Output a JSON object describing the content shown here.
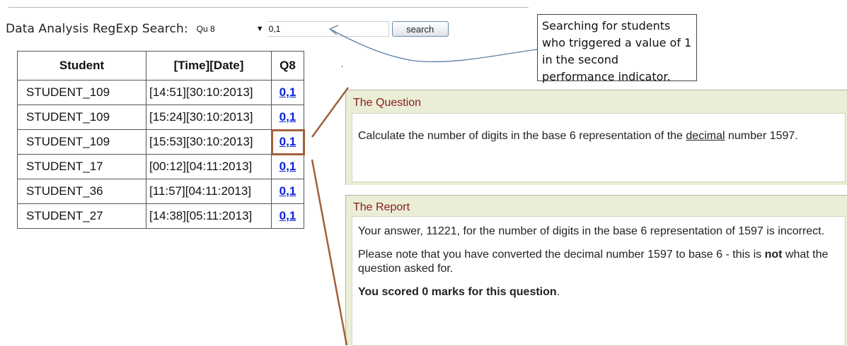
{
  "search": {
    "label": "Data Analysis RegExp Search:",
    "select_value": "Qu 8",
    "query_value": "0,1",
    "button_label": "search"
  },
  "table": {
    "headers": [
      "Student",
      "[Time][Date]",
      "Q8"
    ],
    "rows": [
      {
        "student": "STUDENT_109",
        "time": "[14:51][30:10:2013]",
        "q": "0,1"
      },
      {
        "student": "STUDENT_109",
        "time": "[15:24][30:10:2013]",
        "q": "0,1"
      },
      {
        "student": "STUDENT_109",
        "time": "[15:53][30:10:2013]",
        "q": "0,1"
      },
      {
        "student": "STUDENT_17",
        "time": "[00:12][04:11:2013]",
        "q": "0,1"
      },
      {
        "student": "STUDENT_36",
        "time": "[11:57][04:11:2013]",
        "q": "0,1"
      },
      {
        "student": "STUDENT_27",
        "time": "[14:38][05:11:2013]",
        "q": "0,1"
      }
    ],
    "highlighted_row": 3
  },
  "stray_mark": ".",
  "callout": {
    "text": "Searching for students who triggered a value of 1 in the second performance indicator."
  },
  "question_panel": {
    "title": "The Question",
    "text_before": "Calculate the number of digits in the base 6 representation of the ",
    "text_underlined": "decimal",
    "text_after": " number 1597."
  },
  "report_panel": {
    "title": "The Report",
    "p1": "Your answer, 11221, for the number of digits in the base 6 representation of 1597 is incorrect.",
    "p2_before": "Please note that you have converted the decimal number 1597 to base 6 - this is ",
    "p2_bold": "not",
    "p2_after": " what the question asked for.",
    "score_bold": "You scored 0 marks for this question",
    "score_tail": "."
  },
  "colors": {
    "panel_bg": "#eaeed7",
    "panel_title": "#8a1b1b",
    "link": "#0a22d8",
    "highlight_border": "#a0613a",
    "arrow": "#5b7fa6"
  }
}
